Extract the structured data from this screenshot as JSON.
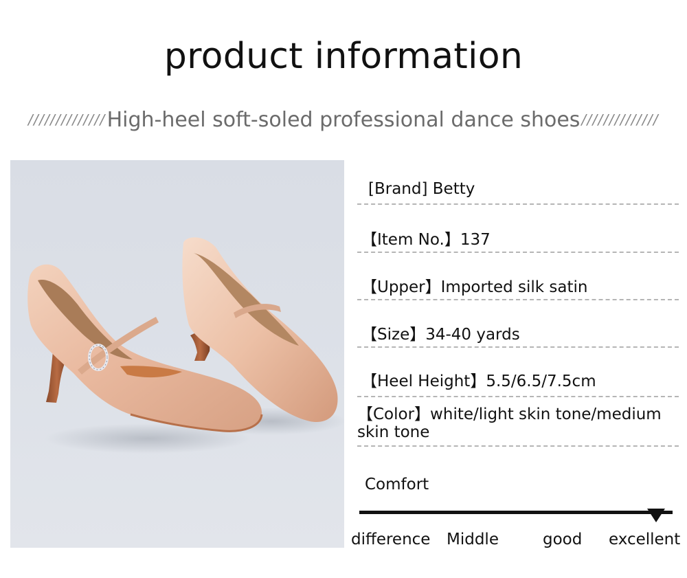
{
  "header": {
    "title": "product information",
    "subtitle": "High-heel soft-soled professional dance shoes",
    "slashes_left": "//////////////",
    "slashes_right": "//////////////"
  },
  "product_image": {
    "subject": "pointed-toe satin dance shoe pair with buckled ankle strap",
    "color": "#e8bca2"
  },
  "specs": [
    {
      "label": "[Brand] Betty"
    },
    {
      "label": "【Item No.】137"
    },
    {
      "label": "【Upper】Imported silk satin"
    },
    {
      "label": "【Size】34-40 yards"
    },
    {
      "label": "【Heel Height】5.5/6.5/7.5cm"
    },
    {
      "label": "【Color】white/light skin tone/medium skin tone"
    }
  ],
  "comfort": {
    "label": "Comfort",
    "levels": [
      "difference",
      "Middle",
      "good",
      "excellent"
    ],
    "selected": "excellent"
  }
}
